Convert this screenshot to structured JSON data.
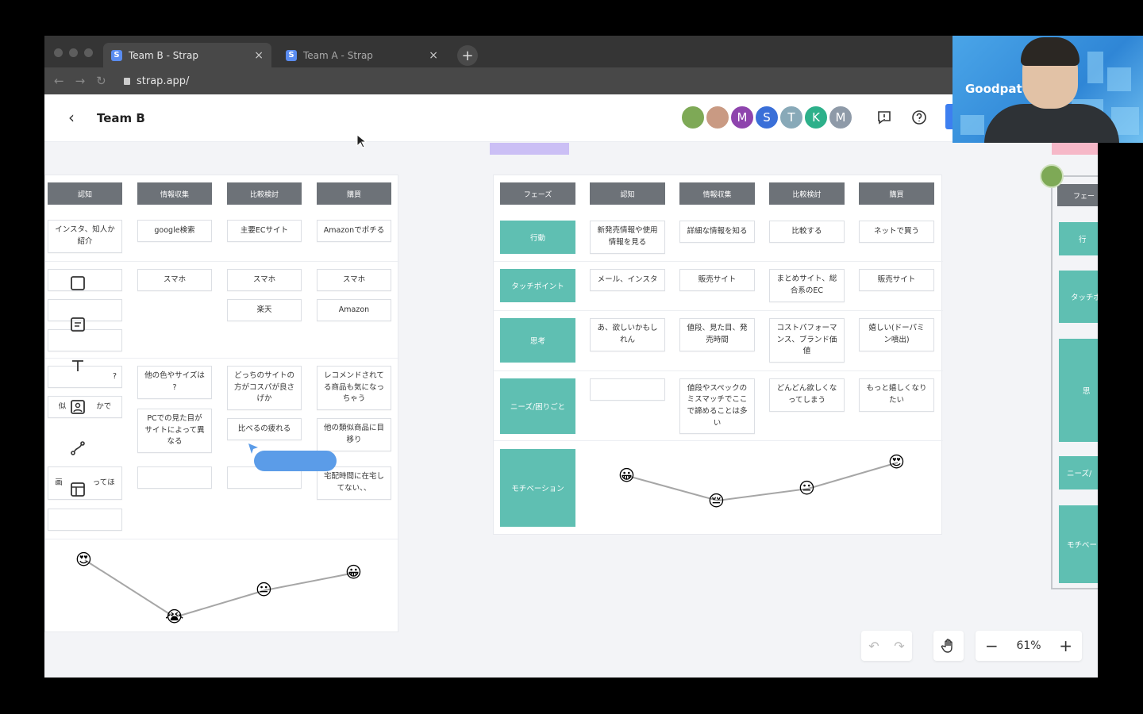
{
  "browser": {
    "tabs": [
      {
        "label": "Team B - Strap",
        "favicon": "S"
      },
      {
        "label": "Team A - Strap",
        "favicon": "S"
      }
    ],
    "url": "strap.app/",
    "new_tab": "+",
    "close": "×"
  },
  "header": {
    "title": "Team B",
    "avatars": [
      {
        "letter": "",
        "color": "#7ea956"
      },
      {
        "letter": "",
        "color": "#c99a83"
      },
      {
        "letter": "M",
        "color": "#8e44ad"
      },
      {
        "letter": "S",
        "color": "#3a6fd8"
      },
      {
        "letter": "T",
        "color": "#88a9b8"
      },
      {
        "letter": "K",
        "color": "#2db08a"
      },
      {
        "letter": "M",
        "color": "#8e9aa8"
      }
    ]
  },
  "left_board": {
    "headers": [
      "認知",
      "情報収集",
      "比較検討",
      "購買"
    ],
    "cards": [
      "インスタ、知人か\n紹介",
      "google検索",
      "主要ECサイト",
      "Amazonでポチる",
      "スマホ",
      "スマホ",
      "スマホ",
      "楽天",
      "Amazon",
      "?",
      "他の色やサイズは\n?",
      "どっちのサイトの\n方がコスパが良さ\nげか",
      "レコメンドされて\nる商品も気になっ\nちゃう",
      "似　　　　かで",
      "PCでの見た目が\nサイトによって異\nなる",
      "比べるの疲れる",
      "他の類似商品に目\n移り",
      "画　　　　ってほ",
      "宅配時間に在宅し\nてない、、"
    ],
    "emotions": [
      "😍",
      "😭",
      "😐",
      "😀"
    ]
  },
  "right_board": {
    "headers": [
      "フェーズ",
      "認知",
      "情報収集",
      "比較検討",
      "購買"
    ],
    "rows": [
      {
        "label": "行動",
        "cells": [
          "新発売情報や使用\n情報を見る",
          "詳細な情報を知る",
          "比較する",
          "ネットで買う"
        ]
      },
      {
        "label": "タッチポイント",
        "cells": [
          "メール、インスタ",
          "販売サイト",
          "まとめサイト、総\n合系のEC",
          "販売サイト"
        ]
      },
      {
        "label": "思考",
        "cells": [
          "あ、欲しいかもし\nれん",
          "値段、見た目、発\n売時間",
          "コストパフォーマ\nンス、ブランド価\n値",
          "嬉しい(ドーパミ\nン噴出)"
        ]
      },
      {
        "label": "ニーズ/困りごと",
        "cells": [
          "",
          "値段やスペックの\nミスマッチでここ\nで諦めることは多\nい",
          "どんどん欲しくな\nってしまう",
          "もっと嬉しくなり\nたい"
        ]
      },
      {
        "label": "モチベーション",
        "cells": []
      }
    ],
    "emotions": [
      "😀",
      "😔",
      "😐",
      "😍"
    ]
  },
  "far_board": {
    "labels": [
      "フェー",
      "行",
      "タッチボ",
      "思",
      "ニーズ/",
      "モチベー"
    ]
  },
  "bottom": {
    "zoom": "61%",
    "minus": "−",
    "plus": "+",
    "undo": "↶",
    "redo": "↷"
  },
  "video": {
    "logo": "Goodpatch"
  }
}
